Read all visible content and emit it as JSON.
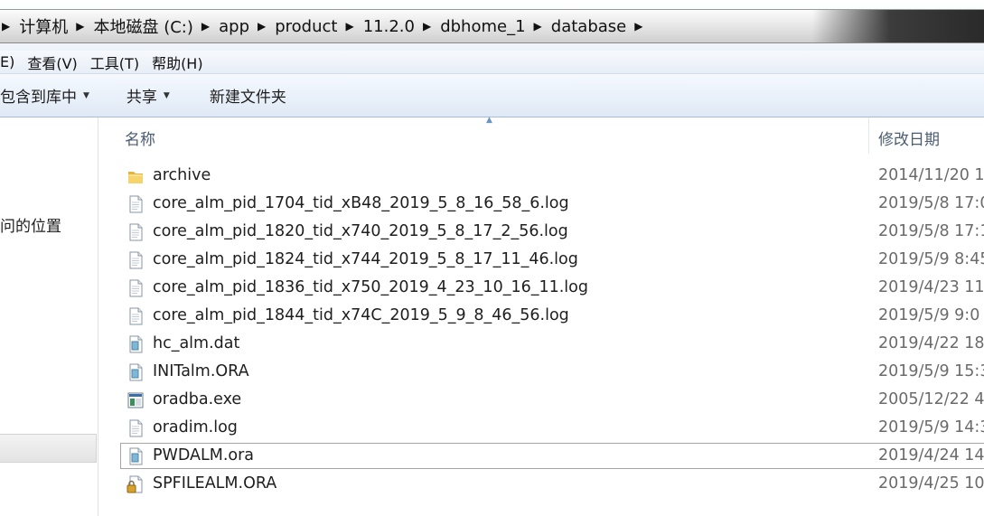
{
  "breadcrumb": [
    "计算机",
    "本地磁盘 (C:)",
    "app",
    "product",
    "11.2.0",
    "dbhome_1",
    "database"
  ],
  "menu": [
    "E)",
    "查看(V)",
    "工具(T)",
    "帮助(H)"
  ],
  "toolbar": {
    "include_library": "包含到库中",
    "share": "共享",
    "new_folder": "新建文件夹"
  },
  "nav": {
    "visible_text": "问的位置"
  },
  "columns": {
    "name": "名称",
    "modified": "修改日期"
  },
  "files": [
    {
      "name": "archive",
      "date": "2014/11/20 1",
      "icon": "folder-icon"
    },
    {
      "name": "core_alm_pid_1704_tid_xB48_2019_5_8_16_58_6.log",
      "date": "2019/5/8 17:0",
      "icon": "text-file-icon"
    },
    {
      "name": "core_alm_pid_1820_tid_x740_2019_5_8_17_2_56.log",
      "date": "2019/5/8 17:1",
      "icon": "text-file-icon"
    },
    {
      "name": "core_alm_pid_1824_tid_x744_2019_5_8_17_11_46.log",
      "date": "2019/5/9 8:45",
      "icon": "text-file-icon"
    },
    {
      "name": "core_alm_pid_1836_tid_x750_2019_4_23_10_16_11.log",
      "date": "2019/4/23 11",
      "icon": "text-file-icon"
    },
    {
      "name": "core_alm_pid_1844_tid_x74C_2019_5_9_8_46_56.log",
      "date": "2019/5/9 9:0",
      "icon": "text-file-icon"
    },
    {
      "name": "hc_alm.dat",
      "date": "2019/4/22 18",
      "icon": "generic-file-icon"
    },
    {
      "name": "INITalm.ORA",
      "date": "2019/5/9 15:3",
      "icon": "generic-file-icon"
    },
    {
      "name": "oradba.exe",
      "date": "2005/12/22 4",
      "icon": "exe-file-icon"
    },
    {
      "name": "oradim.log",
      "date": "2019/5/9 14:3",
      "icon": "text-file-icon"
    },
    {
      "name": "PWDALM.ora",
      "date": "2019/4/24 14",
      "icon": "generic-file-icon",
      "focused": true
    },
    {
      "name": "SPFILEALM.ORA",
      "date": "2019/4/25 10",
      "icon": "locked-file-icon"
    }
  ]
}
